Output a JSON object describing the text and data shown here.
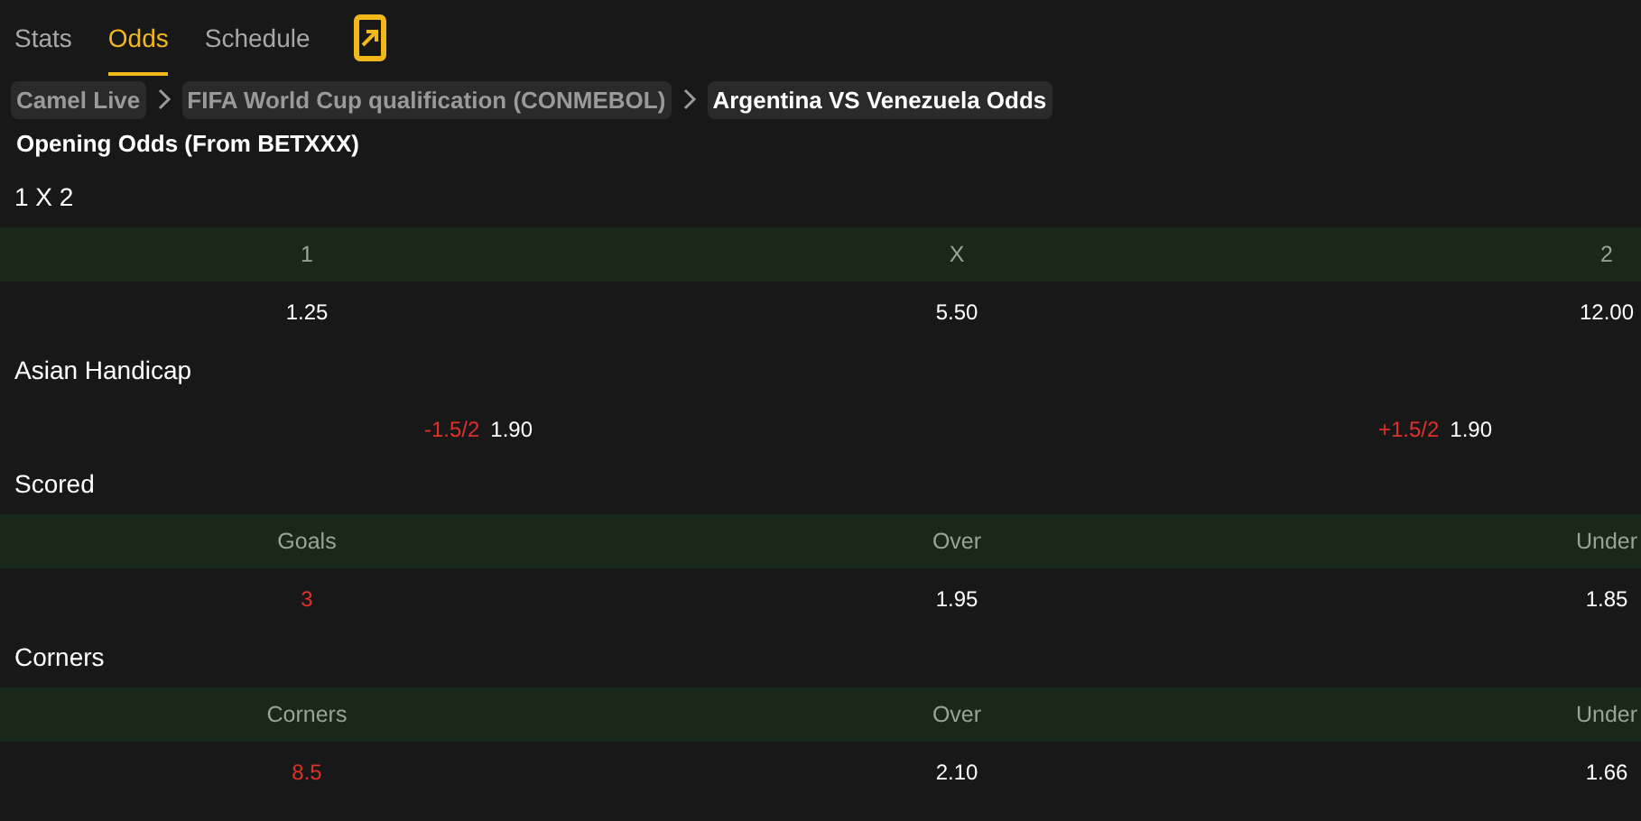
{
  "tabs": [
    {
      "label": "Stats",
      "selected": false
    },
    {
      "label": "Odds",
      "selected": true
    },
    {
      "label": "Schedule",
      "selected": false
    }
  ],
  "breadcrumb": [
    {
      "label": "Camel Live",
      "current": false
    },
    {
      "label": "FIFA World Cup qualification (CONMEBOL)",
      "current": false
    },
    {
      "label": "Argentina VS Venezuela Odds",
      "current": true
    }
  ],
  "subtitle": "Opening Odds (From BETXXX)",
  "sections": [
    {
      "title": "1 X 2",
      "kind": "table",
      "columns": [
        "1",
        "X",
        "2"
      ],
      "rows": [
        [
          {
            "text": "1.25",
            "kind": "odds"
          },
          {
            "text": "5.50",
            "kind": "odds"
          },
          {
            "text": "12.00",
            "kind": "odds"
          }
        ]
      ]
    },
    {
      "title": "Asian Handicap",
      "kind": "pairs",
      "pairs": [
        [
          {
            "text": "-1.5/2",
            "kind": "line"
          },
          {
            "text": "1.90",
            "kind": "odds"
          }
        ],
        [
          {
            "text": "+1.5/2",
            "kind": "line"
          },
          {
            "text": "1.90",
            "kind": "odds"
          }
        ]
      ]
    },
    {
      "title": "Scored",
      "kind": "table",
      "columns": [
        "Goals",
        "Over",
        "Under"
      ],
      "rows": [
        [
          {
            "text": "3",
            "kind": "line"
          },
          {
            "text": "1.95",
            "kind": "odds"
          },
          {
            "text": "1.85",
            "kind": "odds"
          }
        ]
      ]
    },
    {
      "title": "Corners",
      "kind": "table",
      "columns": [
        "Corners",
        "Over",
        "Under"
      ],
      "rows": [
        [
          {
            "text": "8.5",
            "kind": "line"
          },
          {
            "text": "2.10",
            "kind": "odds"
          },
          {
            "text": "1.66",
            "kind": "odds"
          }
        ]
      ]
    }
  ]
}
